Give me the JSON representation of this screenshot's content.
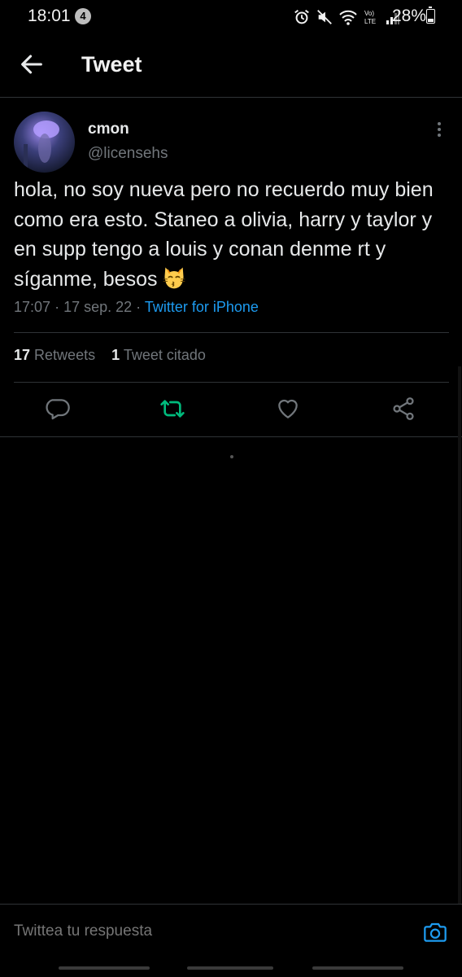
{
  "status_bar": {
    "time": "18:01",
    "notification_count": "4",
    "icons": [
      "alarm-icon",
      "mute-icon",
      "wifi-icon",
      "volte-icon",
      "signal-icon"
    ],
    "volte_label": "Vo)\nLTE",
    "battery": "28%",
    "battery_level": 0.28
  },
  "header": {
    "title": "Tweet",
    "back_icon": "arrow-left-icon"
  },
  "tweet": {
    "author_name": "cmon",
    "author_handle": "@licensehs",
    "text": "hola, no soy nueva pero no recuerdo muy bien como era esto. Staneo a olivia, harry y taylor y en supp tengo a louis y conan denme rt y síganme, besos",
    "emoji": "kissing-cat-emoji",
    "time": "17:07",
    "date": "17 sep. 22",
    "separator": "·",
    "source": "Twitter for iPhone"
  },
  "stats": {
    "retweets_count": "17",
    "retweets_label": "Retweets",
    "quotes_count": "1",
    "quotes_label": "Tweet citado"
  },
  "actions": [
    "reply-icon",
    "retweet-icon",
    "like-icon",
    "share-icon"
  ],
  "colors": {
    "background": "#000000",
    "text": "#e7e9ea",
    "secondary_text": "#71767b",
    "accent": "#1d9bf0",
    "retweet_active": "#00ba7c",
    "divider": "#2f3336"
  },
  "reply_bar": {
    "placeholder": "Twittea tu respuesta",
    "camera_icon": "camera-icon"
  }
}
